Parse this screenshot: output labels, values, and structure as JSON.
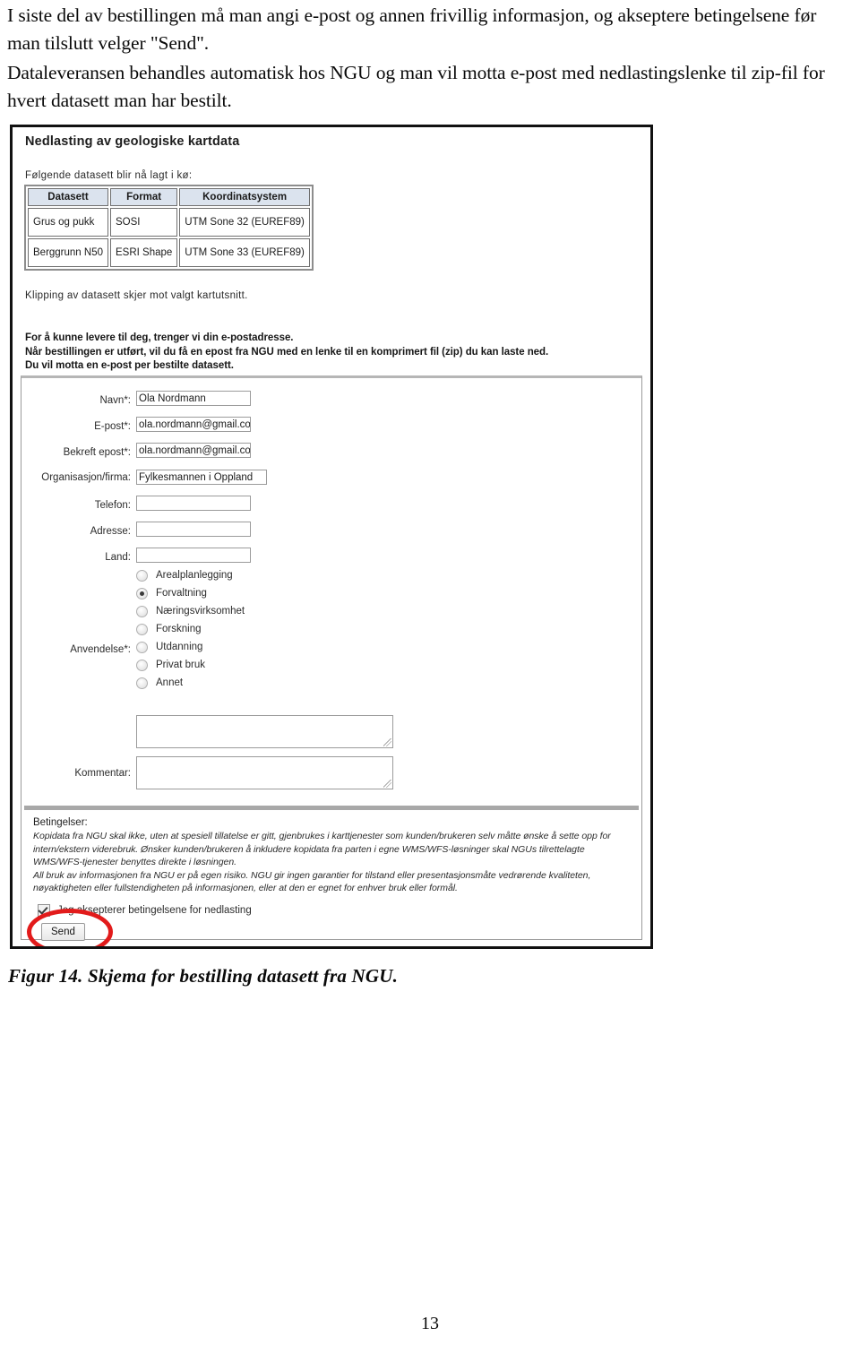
{
  "document": {
    "paragraphs": [
      "I siste del av bestillingen må man angi e-post og annen frivillig informasjon, og akseptere betingelsene før man tilslutt velger \"Send\".",
      "Dataleveransen behandles automatisk hos NGU og man vil motta e-post med nedlastingslenke til zip-fil for hvert datasett man har bestilt."
    ],
    "figure_caption": "Figur 14. Skjema for bestilling datasett fra NGU.",
    "page_number": "13"
  },
  "figure": {
    "app_title": "Nedlasting av geologiske kartdata",
    "queue": {
      "intro": "Følgende datasett blir nå lagt i kø:",
      "columns": [
        "Datasett",
        "Format",
        "Koordinatsystem"
      ],
      "rows": [
        [
          "Grus og pukk",
          "SOSI",
          "UTM Sone 32 (EUREF89)"
        ],
        [
          "Berggrunn N50",
          "ESRI Shape",
          "UTM Sone 33 (EUREF89)"
        ]
      ],
      "note": "Klipping av datasett skjer mot valgt kartutsnitt."
    },
    "email_info": [
      "For å kunne levere til deg, trenger vi din e-postadresse.",
      "Når bestillingen er utført, vil du få en epost fra NGU med en lenke til en komprimert fil (zip) du kan laste ned.",
      "Du vil motta en e-post per bestilte datasett."
    ],
    "form": {
      "fields": [
        {
          "label": "Navn*:",
          "value": "Ola Nordmann",
          "wide": false
        },
        {
          "label": "E-post*:",
          "value": "ola.nordmann@gmail.con",
          "wide": false
        },
        {
          "label": "Bekreft epost*:",
          "value": "ola.nordmann@gmail.con",
          "wide": false
        },
        {
          "label": "Organisasjon/firma:",
          "value": "Fylkesmannen i Oppland",
          "wide": true
        },
        {
          "label": "Telefon:",
          "value": "",
          "wide": false
        },
        {
          "label": "Adresse:",
          "value": "",
          "wide": false
        },
        {
          "label": "Land:",
          "value": "",
          "wide": false
        }
      ],
      "usage": {
        "label": "Anvendelse*:",
        "options": [
          {
            "label": "Arealplanlegging",
            "selected": false
          },
          {
            "label": "Forvaltning",
            "selected": true
          },
          {
            "label": "Næringsvirksomhet",
            "selected": false
          },
          {
            "label": "Forskning",
            "selected": false
          },
          {
            "label": "Utdanning",
            "selected": false
          },
          {
            "label": "Privat bruk",
            "selected": false
          },
          {
            "label": "Annet",
            "selected": false
          }
        ],
        "other_textarea_value": ""
      },
      "comment": {
        "label": "Kommentar:",
        "value": ""
      }
    },
    "terms": {
      "title": "Betingelser:",
      "paragraphs": [
        "Kopidata fra NGU skal ikke, uten at spesiell tillatelse er gitt, gjenbrukes i karttjenester som kunden/brukeren selv måtte ønske å sette opp for intern/ekstern viderebruk. Ønsker kunden/brukeren å inkludere kopidata fra parten i egne WMS/WFS-løsninger skal NGUs tilrettelagte WMS/WFS-tjenester benyttes direkte i løsningen.",
        "All bruk av informasjonen fra NGU er på egen risiko. NGU gir ingen garantier for tilstand eller presentasjonsmåte vedrørende kvaliteten, nøyaktigheten eller fullstendigheten på informasjonen, eller at den er egnet for enhver bruk eller formål."
      ]
    },
    "accept": {
      "label": "Jeg aksepterer betingelsene for nedlasting",
      "checked": true
    },
    "send_button_label": "Send",
    "annotation_color": "#e21b1b"
  }
}
